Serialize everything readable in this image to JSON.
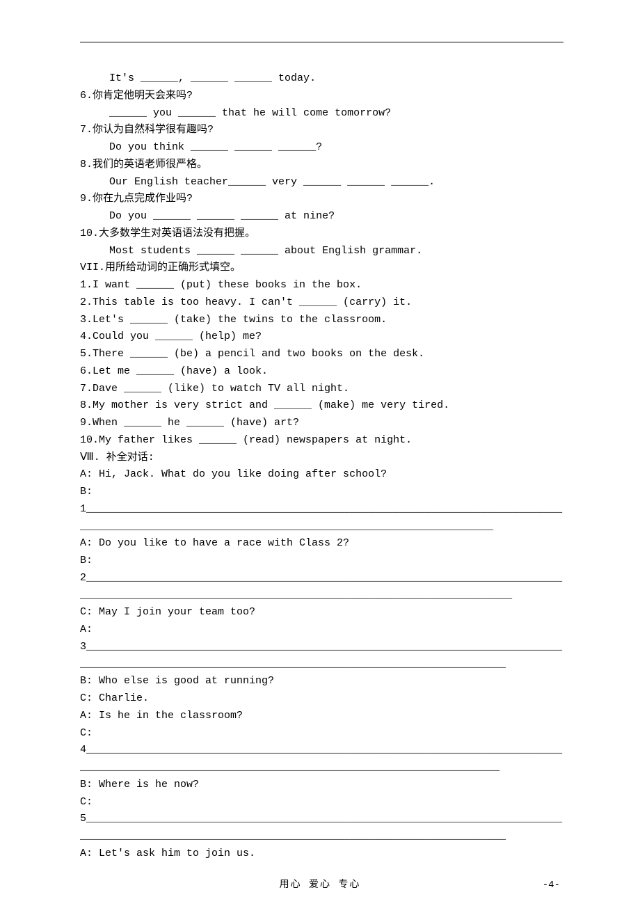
{
  "q5": {
    "indented": "  It's ______, ______ ______ today."
  },
  "q6": {
    "prompt": "6.你肯定他明天会来吗?",
    "indented": "  ______ you ______ that he will come tomorrow?"
  },
  "q7": {
    "prompt": "7.你认为自然科学很有趣吗?",
    "indented": "  Do you think ______ ______ ______?"
  },
  "q8": {
    "prompt": "8.我们的英语老师很严格。",
    "indented": "  Our English teacher______ very ______ ______ ______."
  },
  "q9": {
    "prompt": "9.你在九点完成作业吗?",
    "indented": "  Do you ______ ______ ______ at nine?"
  },
  "q10": {
    "prompt": "10.大多数学生对英语语法没有把握。",
    "indented": "  Most students ______ ______ about English grammar."
  },
  "section_vii": "VII.用所给动词的正确形式填空。",
  "vii": {
    "1": "1.I want ______ (put) these books in the box.",
    "2": "2.This table is too heavy. I can't ______ (carry) it.",
    "3": "3.Let's ______ (take) the twins to the classroom.",
    "4": "4.Could you ______ (help) me?",
    "5": "5.There ______ (be) a pencil and two books on the desk.",
    "6": "6.Let me ______ (have) a look.",
    "7": "7.Dave ______ (like) to watch TV all night.",
    "8": "8.My mother is very strict and ______ (make) me very tired.",
    "9": "9.When ______ he ______ (have) art?",
    "10": "10.My father likes ______ (read) newspapers at night."
  },
  "section_viii": "Ⅷ. 补全对话:",
  "dlg": {
    "a1": "A: Hi, Jack. What do you like doing after school?",
    "b1": "B:",
    "ans1": "1______________________________________________________________________________________________________________________________________________",
    "a2": "A: Do you like to have a race with Class 2?",
    "b2": "B:",
    "ans2": "2_________________________________________________________________________________________________________________________________________________",
    "c1": "C: May I join your team too?",
    "a3": "A:",
    "ans3": "3________________________________________________________________________________________________________________________________________________",
    "b3": "B: Who else is good at running?",
    "c2": "C: Charlie.",
    "a4": "A: Is he in the classroom?",
    "c3": "C:",
    "ans4": "4_______________________________________________________________________________________________________________________________________________",
    "b4": "B: Where is he now?",
    "c4": "C:",
    "ans5": "5________________________________________________________________________________________________________________________________________________",
    "a5": "A: Let's ask him to join us."
  },
  "footer": "用心  爱心  专心",
  "pagenum": "-4-"
}
